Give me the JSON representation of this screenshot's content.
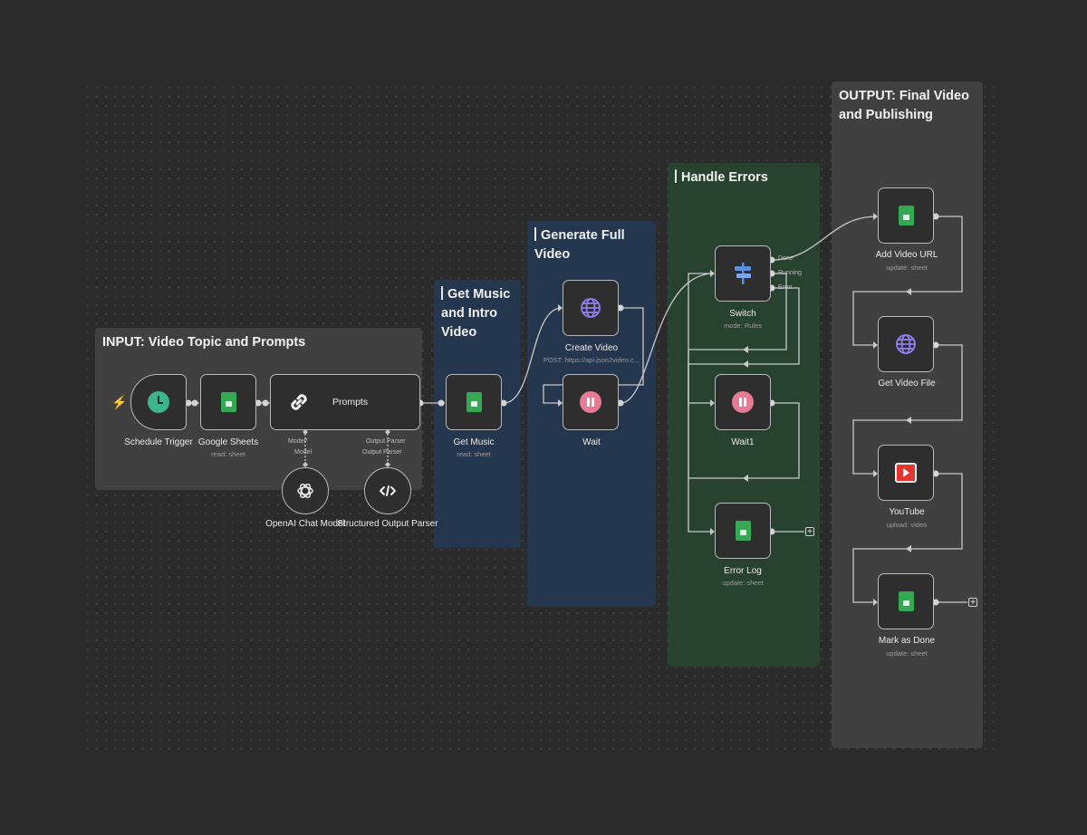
{
  "canvas": {
    "background": "#2b2b2c",
    "accent_colors": {
      "sheets_green": "#34a853",
      "globe_purple": "#7d6ee8",
      "wait_pink": "#e87a94",
      "trigger_teal": "#3cb58d",
      "youtube_red": "#e3342f",
      "trigger_bolt": "#ff6d5a",
      "blue_group": "#25364f",
      "green_group": "#27432f",
      "grey_group": "#404041"
    }
  },
  "groups": {
    "input": {
      "title": "INPUT: Video Topic and Prompts"
    },
    "music": {
      "title": "Get Music and Intro Video"
    },
    "generate": {
      "title": "Generate Full Video"
    },
    "errors": {
      "title": "Handle Errors"
    },
    "output": {
      "title": "OUTPUT: Final Video and Publishing"
    }
  },
  "nodes": {
    "schedule_trigger": {
      "label": "Schedule Trigger",
      "icon": "clock-icon"
    },
    "google_sheets": {
      "label": "Google Sheets",
      "sub": "read: sheet",
      "icon": "sheets-icon"
    },
    "prompts": {
      "label": "Prompts",
      "icon": "link-icon",
      "handle_model": "Model*",
      "handle_parser": "Output Parser"
    },
    "openai_chat_model": {
      "label": "OpenAI Chat Model",
      "icon": "openai-icon",
      "handle": "Model"
    },
    "structured_output_parser": {
      "label": "Structured Output Parser",
      "icon": "code-icon",
      "handle": "Output Parser"
    },
    "get_music": {
      "label": "Get Music",
      "sub": "read: sheet",
      "icon": "sheets-icon"
    },
    "create_video": {
      "label": "Create Video",
      "sub": "POST: https://api.json2video.c...",
      "icon": "globe-icon"
    },
    "wait": {
      "label": "Wait",
      "icon": "pause-icon"
    },
    "switch": {
      "label": "Switch",
      "sub": "mode: Rules",
      "icon": "signpost-icon",
      "outputs": [
        "Done",
        "Running",
        "Error"
      ]
    },
    "wait1": {
      "label": "Wait1",
      "icon": "pause-icon"
    },
    "error_log": {
      "label": "Error Log",
      "sub": "update: sheet",
      "icon": "sheets-icon"
    },
    "add_video_url": {
      "label": "Add Video URL",
      "sub": "update: sheet",
      "icon": "sheets-icon"
    },
    "get_video_file": {
      "label": "Get Video File",
      "icon": "globe-icon"
    },
    "youtube": {
      "label": "YouTube",
      "sub": "upload: video",
      "icon": "youtube-icon"
    },
    "mark_as_done": {
      "label": "Mark as Done",
      "sub": "update: sheet",
      "icon": "sheets-icon"
    }
  },
  "controls": {
    "add_symbol": "+",
    "trigger_symbol": "⚡"
  }
}
